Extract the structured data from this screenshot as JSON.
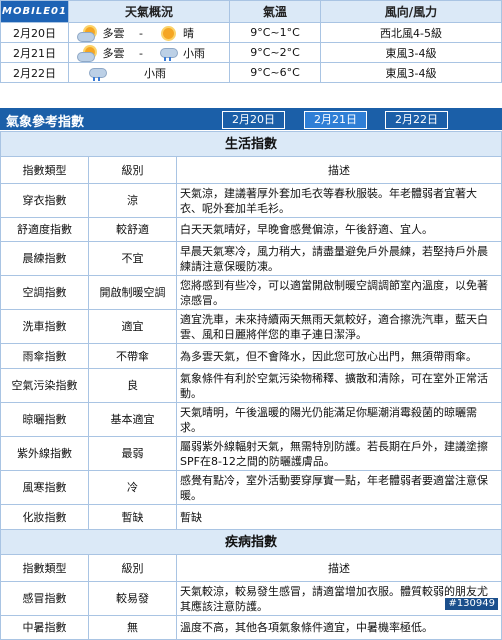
{
  "logo": "MOBILE01",
  "forecast": {
    "headers": {
      "weather": "天氣概況",
      "temp": "氣溫",
      "wind": "風向/風力"
    },
    "rows": [
      {
        "date": "2月20日",
        "w1": "多雲",
        "sep": "-",
        "w2": "晴",
        "temp": "9°C~1°C",
        "wind": "西北風4-5級",
        "icon1": "cloudy-sun-icon",
        "icon2": "sun-icon"
      },
      {
        "date": "2月21日",
        "w1": "多雲",
        "sep": "-",
        "w2": "小雨",
        "temp": "9°C~2°C",
        "wind": "東風3-4級",
        "icon1": "cloudy-sun-icon",
        "icon2": "light-rain-icon"
      },
      {
        "date": "2月22日",
        "w1": "",
        "sep": "",
        "w2": "小雨",
        "temp": "9°C~6°C",
        "wind": "東風3-4級",
        "icon1": "",
        "icon2": "light-rain-icon"
      }
    ]
  },
  "ref": {
    "title": "氣象參考指數",
    "tabs": [
      {
        "label": "2月20日",
        "active": false
      },
      {
        "label": "2月21日",
        "active": true
      },
      {
        "label": "2月22日",
        "active": false
      }
    ]
  },
  "life": {
    "section_title": "生活指數",
    "col_type": "指數類型",
    "col_level": "級別",
    "col_desc": "描述",
    "rows": [
      {
        "type": "穿衣指數",
        "level": "涼",
        "desc": "天氣涼，建議著厚外套加毛衣等春秋服裝。年老體弱者宜著大衣、呢外套加羊毛衫。"
      },
      {
        "type": "舒適度指數",
        "level": "較舒適",
        "desc": "白天天氣晴好，早晚會感覺偏涼，午後舒適、宜人。"
      },
      {
        "type": "晨練指數",
        "level": "不宜",
        "desc": "早晨天氣寒冷，風力稍大，請盡量避免戶外晨練，若堅持戶外晨練請注意保暖防凍。"
      },
      {
        "type": "空調指數",
        "level": "開啟制暖空調",
        "desc": "您將感到有些冷，可以適當開啟制暖空調調節室內溫度，以免著涼感冒。"
      },
      {
        "type": "洗車指數",
        "level": "適宜",
        "desc": "適宜洗車，未來持續兩天無雨天氣較好，適合擦洗汽車，藍天白雲、風和日麗將伴您的車子連日潔淨。"
      },
      {
        "type": "雨傘指數",
        "level": "不帶傘",
        "desc": "為多雲天氣，但不會降水，因此您可放心出門，無須帶雨傘。"
      },
      {
        "type": "空氣污染指數",
        "level": "良",
        "desc": "氣象條件有利於空氣污染物稀釋、擴散和清除，可在室外正常活動。"
      },
      {
        "type": "晾曬指數",
        "level": "基本適宜",
        "desc": "天氣晴明，午後溫暖的陽光仍能滿足你驅潮消霉殺菌的晾曬需求。"
      },
      {
        "type": "紫外線指數",
        "level": "最弱",
        "desc": "屬弱紫外線輻射天氣，無需特別防護。若長期在戶外，建議塗擦SPF在8-12之間的防曬護膚品。"
      },
      {
        "type": "風寒指數",
        "level": "冷",
        "desc": "感覺有點冷，室外活動要穿厚實一點，年老體弱者要適當注意保暖。"
      },
      {
        "type": "化妝指數",
        "level": "暫缺",
        "desc": "暫缺"
      }
    ]
  },
  "disease": {
    "section_title": "疾病指數",
    "col_type": "指數類型",
    "col_level": "級別",
    "col_desc": "描述",
    "rows": [
      {
        "type": "感冒指數",
        "level": "較易發",
        "desc": "天氣較涼，較易發生感冒，請適當增加衣服。體質較弱的朋友尤其應該注意防護。"
      },
      {
        "type": "中暑指數",
        "level": "無",
        "desc": "溫度不高，其他各項氣象條件適宜，中暑機率極低。"
      }
    ]
  },
  "watermark": "#130949"
}
